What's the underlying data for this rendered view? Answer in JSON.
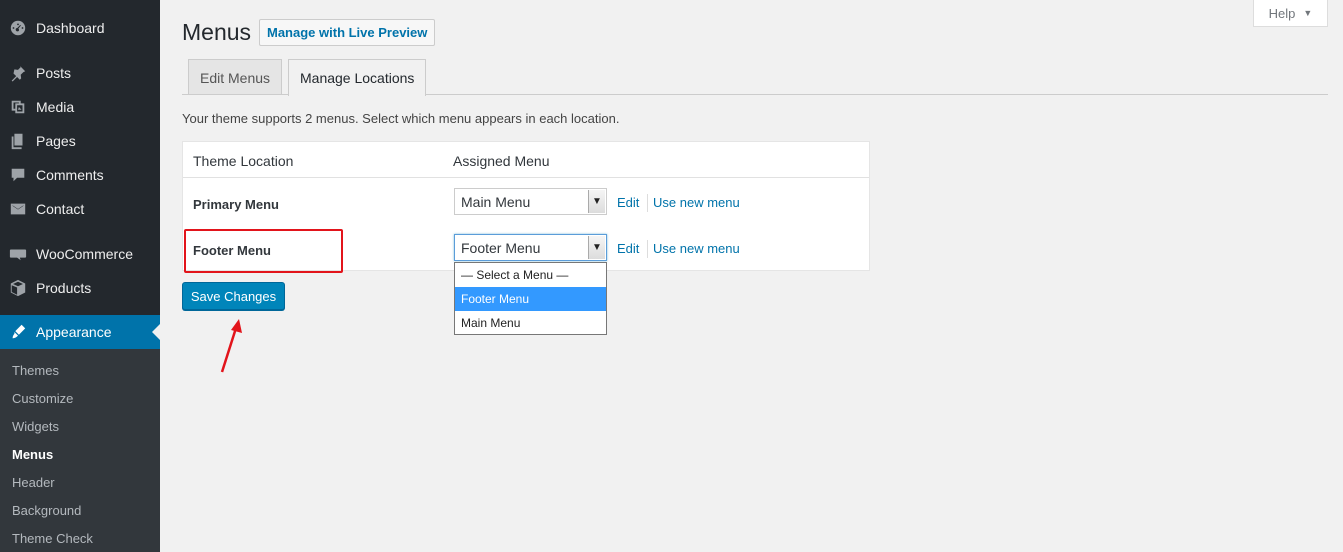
{
  "sidebar": {
    "items": [
      {
        "label": "Dashboard",
        "icon": "dashboard-icon"
      },
      {
        "label": "Posts",
        "icon": "pin-icon"
      },
      {
        "label": "Media",
        "icon": "media-icon"
      },
      {
        "label": "Pages",
        "icon": "pages-icon"
      },
      {
        "label": "Comments",
        "icon": "comment-icon"
      },
      {
        "label": "Contact",
        "icon": "mail-icon"
      },
      {
        "label": "WooCommerce",
        "icon": "woo-icon"
      },
      {
        "label": "Products",
        "icon": "box-icon"
      },
      {
        "label": "Appearance",
        "icon": "brush-icon",
        "current": true
      }
    ],
    "submenu": [
      {
        "label": "Themes"
      },
      {
        "label": "Customize"
      },
      {
        "label": "Widgets"
      },
      {
        "label": "Menus",
        "current": true
      },
      {
        "label": "Header"
      },
      {
        "label": "Background"
      },
      {
        "label": "Theme Check"
      }
    ]
  },
  "header": {
    "help_label": "Help",
    "title": "Menus",
    "live_preview_label": "Manage with Live Preview"
  },
  "tabs": [
    {
      "label": "Edit Menus"
    },
    {
      "label": "Manage Locations",
      "active": true
    }
  ],
  "description": "Your theme supports 2 menus. Select which menu appears in each location.",
  "locations_table": {
    "headers": [
      "Theme Location",
      "Assigned Menu"
    ],
    "rows": [
      {
        "location": "Primary Menu",
        "selected": "Main Menu",
        "edit_label": "Edit",
        "new_label": "Use new menu"
      },
      {
        "location": "Footer Menu",
        "selected": "Footer Menu",
        "edit_label": "Edit",
        "new_label": "Use new menu"
      }
    ]
  },
  "dropdown_options": [
    {
      "label": "— Select a Menu —"
    },
    {
      "label": "Footer Menu",
      "selected": true
    },
    {
      "label": "Main Menu"
    }
  ],
  "save_label": "Save Changes",
  "colors": {
    "sidebar_bg": "#23282d",
    "accent": "#0073aa",
    "button": "#0085ba",
    "annotation": "#e2141b",
    "dropdown_highlight": "#3399ff"
  }
}
